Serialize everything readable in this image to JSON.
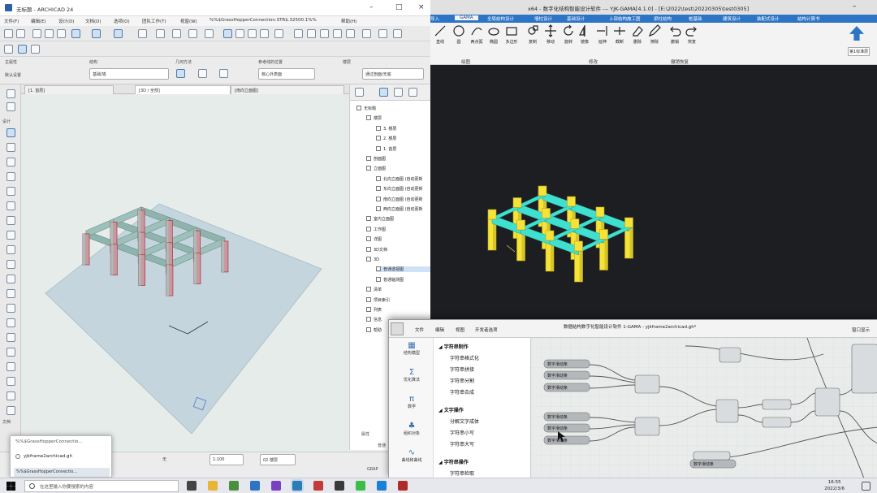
{
  "archicad": {
    "title": "无标题 - ARCHICAD 24",
    "menu": [
      "文件(F)",
      "编辑(E)",
      "设计(D)",
      "文档(D)",
      "选项(O)",
      "团队工作(T)",
      "视窗(W)",
      "%%$GrassHopperConnection.STR$.32500.1%%",
      "帮助(H)"
    ],
    "info": {
      "main_label": "主属性",
      "main_value": "默认设置",
      "geometry_label": "几何方法",
      "structure_label": "结构",
      "ref_label": "参考线的位置",
      "floor_label": "楼层",
      "ref_value": "核心外表面",
      "structure_value": "基础/墙",
      "storey_value": "图形/剖面",
      "pattern_value": "通过剖面/无底"
    },
    "view_tabs": [
      {
        "label": "[1. 首层]"
      },
      {
        "label": "[3D / 全部]"
      },
      {
        "label": "[南向立面图]"
      }
    ],
    "nav": {
      "tree": [
        {
          "label": "无标题",
          "lvl": 0
        },
        {
          "label": "楼层",
          "lvl": 1
        },
        {
          "label": "3. 楼层",
          "lvl": 2
        },
        {
          "label": "2. 楼层",
          "lvl": 2
        },
        {
          "label": "1. 首层",
          "lvl": 2
        },
        {
          "label": "剖面图",
          "lvl": 1
        },
        {
          "label": "立面图",
          "lvl": 1
        },
        {
          "label": "北向立面图 (自动更新",
          "lvl": 2
        },
        {
          "label": "东向立面图 (自动更新",
          "lvl": 2
        },
        {
          "label": "南向立面图 (自动更新",
          "lvl": 2
        },
        {
          "label": "西向立面图 (自动更新",
          "lvl": 2
        },
        {
          "label": "室内立面图",
          "lvl": 1
        },
        {
          "label": "工作图",
          "lvl": 1
        },
        {
          "label": "详图",
          "lvl": 1
        },
        {
          "label": "3D文档",
          "lvl": 1
        },
        {
          "label": "3D",
          "lvl": 1
        },
        {
          "label": "普通透视图",
          "lvl": 2,
          "selected": true
        },
        {
          "label": "普通轴测图",
          "lvl": 2
        },
        {
          "label": "清单",
          "lvl": 1
        },
        {
          "label": "项目索引",
          "lvl": 1
        },
        {
          "label": "列表",
          "lvl": 1
        },
        {
          "label": "信息",
          "lvl": 1
        },
        {
          "label": "帮助",
          "lvl": 1
        }
      ],
      "bottom_label": "属性",
      "bottom_item": "普通",
      "grapher": "GRAP"
    },
    "left_tool_label": "设计",
    "left_doc_label": "文档",
    "status": {
      "zoom": "1:100",
      "layer": "02 楼层",
      "undo": "无"
    },
    "popup": {
      "title": "%%$GrassHopperConnectio...",
      "file": "yjkframe2archicad.gh",
      "item": "%%$GrassHopperConnectio..."
    }
  },
  "gama": {
    "title": "x64 - 数字化结构智能设计软件 --- YJK-GAMA[4.1.0] - [E:\\2022\\test\\20220305\\test0305]",
    "tabs": [
      "导入",
      "GAMA",
      "全局结构设计",
      "墙柱设计",
      "基础设计",
      "上部结构施工图",
      "梁柱结构",
      "桩基础",
      "建筑设计",
      "装配式设计",
      "结构计算书"
    ],
    "active_tab": "GAMA",
    "ribbon": [
      {
        "label": "直线",
        "g": "line"
      },
      {
        "label": "圆",
        "g": "circle"
      },
      {
        "label": "两点弧",
        "g": "arc"
      },
      {
        "label": "椭圆",
        "g": "ellipse"
      },
      {
        "label": "多边形",
        "g": "rect"
      },
      {
        "label": "复制",
        "g": "copy"
      },
      {
        "label": "移动",
        "g": "move"
      },
      {
        "label": "旋转",
        "g": "rotate"
      },
      {
        "label": "镜像",
        "g": "mirror"
      },
      {
        "label": "延伸",
        "g": "extend"
      },
      {
        "label": "截断",
        "g": "cut"
      },
      {
        "label": "删除",
        "g": "erase"
      },
      {
        "label": "擦除",
        "g": "pen"
      },
      {
        "label": "撤销",
        "g": "undo"
      },
      {
        "label": "恢复",
        "g": "redo"
      }
    ],
    "groups": [
      "绘图",
      "修改",
      "撤销恢复"
    ],
    "right_label": "第1标准层",
    "colors": {
      "beam": "#3fe0cf",
      "column": "#f5e33a",
      "bg": "#1d1e22"
    }
  },
  "grasshopper": {
    "menu": [
      "文件",
      "编辑",
      "视图",
      "开发者选项"
    ],
    "title": "数据结构数字化智能设计软件 1-GAMA - yjkframe2archicad.gh*",
    "side": [
      {
        "label": "结构模型",
        "sym": "▦"
      },
      {
        "label": "优化算法",
        "sym": "Σ"
      },
      {
        "label": "数学",
        "sym": "π"
      },
      {
        "label": "组织对象",
        "sym": "♣"
      },
      {
        "label": "曲线和曲线",
        "sym": "∿"
      }
    ],
    "list": [
      {
        "t": "字符串制作",
        "h": true
      },
      {
        "t": "字符串格式化",
        "h": false
      },
      {
        "t": "字符串拼接",
        "h": false
      },
      {
        "t": "字符串分割",
        "h": false
      },
      {
        "t": "字符串合成",
        "h": false
      },
      {
        "t": "文字操作",
        "h": true
      },
      {
        "t": "分解文字成体",
        "h": false
      },
      {
        "t": "字符串小写",
        "h": false
      },
      {
        "t": "字符串大写",
        "h": false
      },
      {
        "t": "字符串操作",
        "h": true
      },
      {
        "t": "字符串检取",
        "h": false
      }
    ],
    "right_label": "窗口显示",
    "node_labels": [
      "数字滑动条",
      "数字滑动条",
      "数字滑动条",
      "数字滑动条",
      "数字滑动条",
      "数字滑动条",
      "数字滑动条",
      "数字滑动条",
      "数字滑动条"
    ]
  },
  "taskbar": {
    "search": "在这里输入你要搜索的内容",
    "time": "16:55",
    "date": "2022/3/6",
    "icons": [
      "task-view",
      "explorer",
      "chrome",
      "mail",
      "vs",
      "gama",
      "paint",
      "store",
      "wechat",
      "edge",
      "archicad"
    ]
  }
}
